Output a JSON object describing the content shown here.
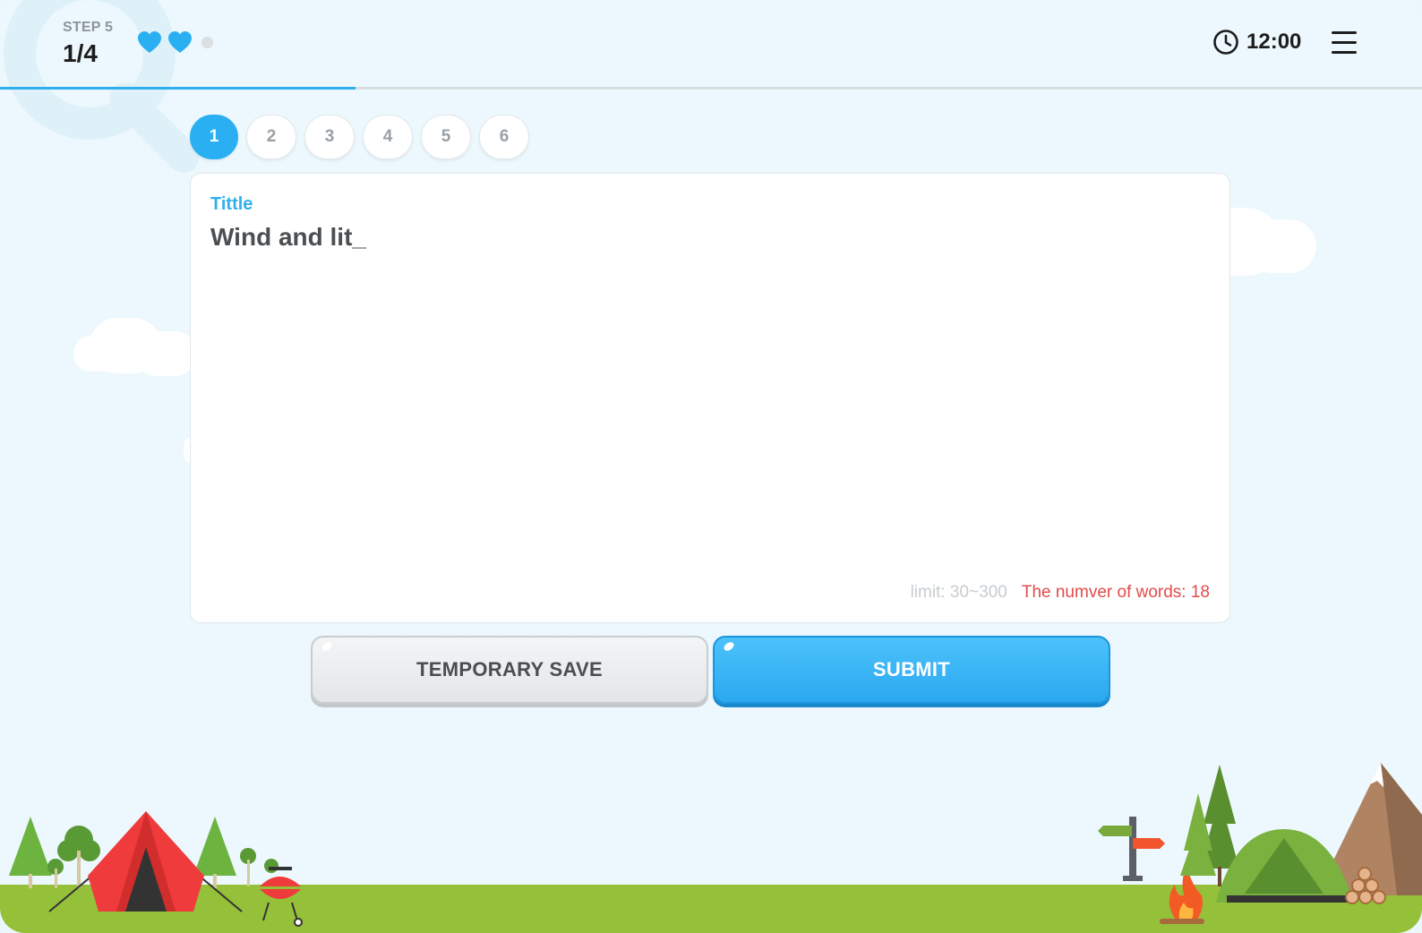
{
  "header": {
    "step_label": "STEP 5",
    "step_progress": "1/4",
    "lives": [
      "heart-icon",
      "heart-icon",
      "empty-dot-icon"
    ],
    "timer": "12:00",
    "progress_fraction": 0.25
  },
  "tabs": [
    {
      "label": "1",
      "active": true
    },
    {
      "label": "2",
      "active": false
    },
    {
      "label": "3",
      "active": false
    },
    {
      "label": "4",
      "active": false
    },
    {
      "label": "5",
      "active": false
    },
    {
      "label": "6",
      "active": false
    }
  ],
  "editor": {
    "label": "Tittle",
    "value": "Wind and lit_",
    "limit": "limit: 30~300",
    "word_count": "The numver of words: 18"
  },
  "buttons": {
    "temporary_save": "TEMPORARY SAVE",
    "submit": "SUBMIT"
  },
  "colors": {
    "accent": "#2ab0f2",
    "background": "#ecf8fd",
    "grass": "#95c13a",
    "warning": "#e24b4b"
  }
}
